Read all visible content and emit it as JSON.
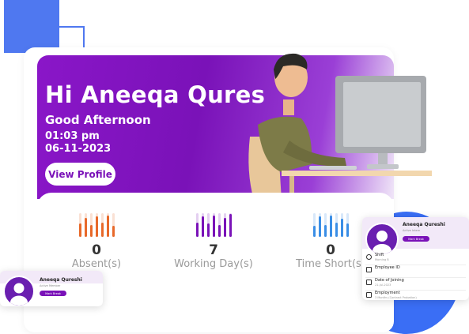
{
  "greeting": {
    "title": "Hi Aneeqa Qures",
    "subtitle": "Good Afternoon",
    "time": "01:03 pm",
    "date": "06-11-2023",
    "view_profile_label": "View Profile"
  },
  "colors": {
    "brand_purple": "#7a12b8",
    "accent_blue": "#4f78f0",
    "absent_orange": "#e8692a",
    "working_purple": "#7a12b8",
    "short_blue": "#3a8ee6"
  },
  "stats": [
    {
      "value": "0",
      "label": "Absent(s)",
      "color": "#e8692a",
      "bars": [
        0.55,
        0.8,
        0.5,
        0.85,
        0.6,
        0.9,
        0.45
      ]
    },
    {
      "value": "7",
      "label": "Working Day(s)",
      "color": "#7a12b8",
      "bars": [
        0.6,
        0.85,
        0.55,
        0.9,
        0.5,
        0.8,
        0.95
      ]
    },
    {
      "value": "0",
      "label": "Time Short(s)",
      "color": "#3a8ee6",
      "bars": [
        0.45,
        0.85,
        0.5,
        0.9,
        0.6,
        0.75,
        0.55
      ]
    }
  ],
  "profile_card_right": {
    "name": "Aneeqa Qureshi",
    "subtitle": "Active Intern",
    "button_label": "Mark Break",
    "rows": [
      {
        "icon": "clock-icon",
        "title": "Shift",
        "sub": "Morning B"
      },
      {
        "icon": "id-card-icon",
        "title": "Employee ID",
        "sub": ""
      },
      {
        "icon": "calendar-icon",
        "title": "Date of Joining",
        "sub": "21-Jul-2023"
      },
      {
        "icon": "briefcase-icon",
        "title": "Employment",
        "sub": "3 Months (Contract Probation)"
      }
    ]
  },
  "profile_card_left": {
    "name": "Aneeqa Qureshi",
    "subtitle": "Active Member",
    "button_label": "Mark Break"
  }
}
